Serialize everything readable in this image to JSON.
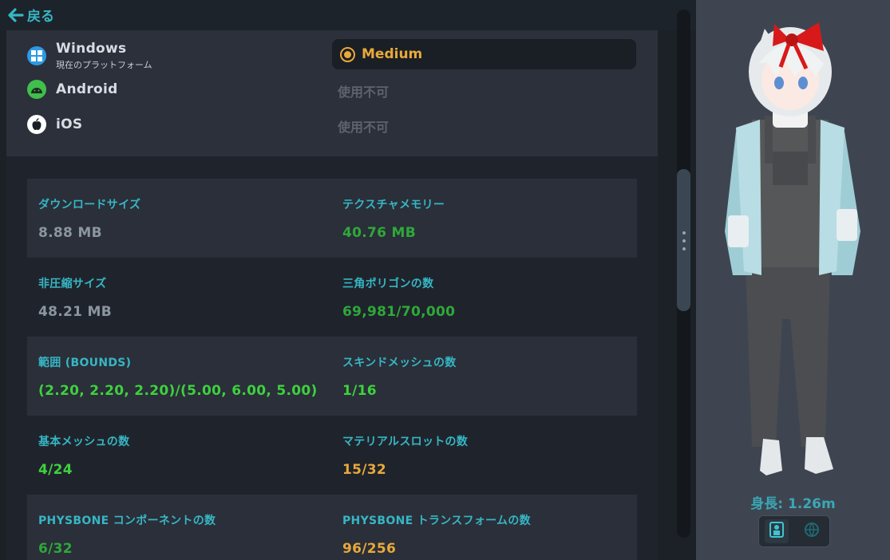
{
  "nav": {
    "back_label": "戻る"
  },
  "platforms": [
    {
      "name": "Windows",
      "subtitle": "現在のプラットフォーム",
      "status": "Medium",
      "icon": "windows-icon",
      "color": "#2b9ae6"
    },
    {
      "name": "Android",
      "subtitle": "",
      "status": "使用不可",
      "icon": "android-icon",
      "color": "#3fbf4c"
    },
    {
      "name": "iOS",
      "subtitle": "",
      "status": "使用不可",
      "icon": "apple-icon",
      "color": "#ffffff"
    }
  ],
  "performance": {
    "rating": "Medium",
    "color": "#e8a93a"
  },
  "stats": [
    {
      "label": "ダウンロードサイズ",
      "value": "8.88 MB",
      "color": "#8c96a0"
    },
    {
      "label": "テクスチャメモリー",
      "value": "40.76 MB",
      "color": "#2fa83a"
    },
    {
      "label": "非圧縮サイズ",
      "value": "48.21 MB",
      "color": "#8c96a0"
    },
    {
      "label": "三角ポリゴンの数",
      "value": "69,981/70,000",
      "color": "#2fa83a"
    },
    {
      "label": "範囲 (BOUNDS)",
      "value": "(2.20, 2.20, 2.20)/(5.00, 6.00, 5.00)",
      "color": "#3ed13e"
    },
    {
      "label": "スキンドメッシュの数",
      "value": "1/16",
      "color": "#3ed13e"
    },
    {
      "label": "基本メッシュの数",
      "value": "4/24",
      "color": "#3ed13e"
    },
    {
      "label": "マテリアルスロットの数",
      "value": "15/32",
      "color": "#e8a93a"
    },
    {
      "label": "PHYSBONE コンポーネントの数",
      "value": "6/32",
      "color": "#2fa83a"
    },
    {
      "label": "PHYSBONE トランスフォームの数",
      "value": "96/256",
      "color": "#e8a93a"
    }
  ],
  "preview": {
    "height_label": "身長: 1.26m",
    "view_buttons": [
      {
        "icon": "avatar-view-icon",
        "active": true
      },
      {
        "icon": "globe-view-icon",
        "active": false
      }
    ]
  },
  "colors": {
    "accent": "#37b6c4",
    "good": "#2fa83a",
    "excellent": "#3ed13e",
    "medium": "#e8a93a"
  }
}
